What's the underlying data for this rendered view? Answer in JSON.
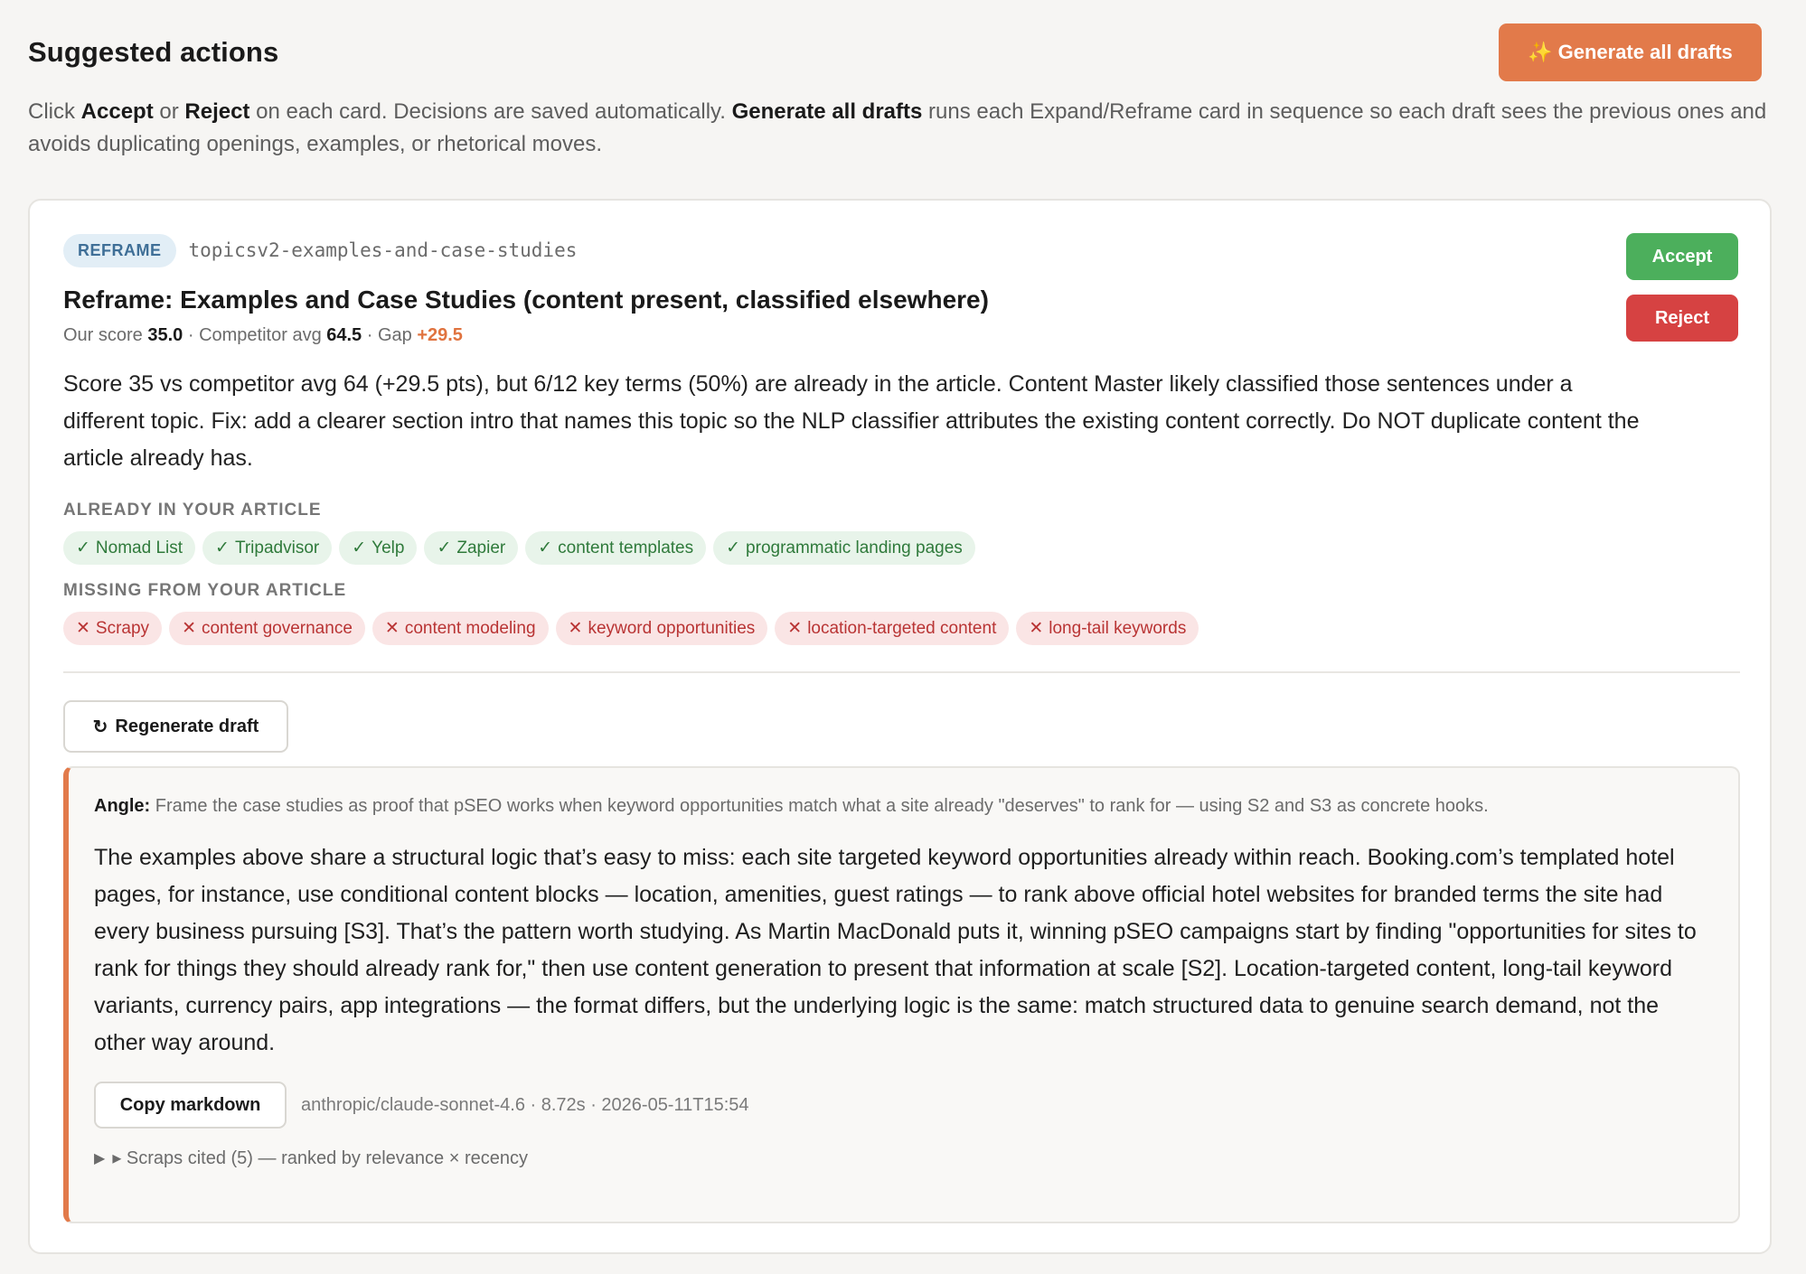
{
  "header": {
    "title": "Suggested actions",
    "generate_all": {
      "icon": "✨",
      "label": "Generate all drafts"
    }
  },
  "intro": {
    "t1": "Click ",
    "b1": "Accept",
    "t2": " or ",
    "b2": "Reject",
    "t3": " on each card. Decisions are saved automatically. ",
    "b3": "Generate all drafts",
    "t4": " runs each Expand/Reframe card in sequence so each draft sees the previous ones and avoids duplicating openings, examples, or rhetorical moves."
  },
  "card": {
    "tag": "REFRAME",
    "slug": "topicsv2-examples-and-case-studies",
    "title": "Reframe: Examples and Case Studies (content present, classified elsewhere)",
    "score": {
      "our_label": "Our score ",
      "our_value": "35.0",
      "comp_label": " · Competitor avg ",
      "comp_value": "64.5",
      "gap_label": " · Gap ",
      "gap_value": "+29.5"
    },
    "description": "Score 35 vs competitor avg 64 (+29.5 pts), but 6/12 key terms (50%) are already in the article. Content Master likely classified those sentences under a different topic. Fix: add a clearer section intro that names this topic so the NLP classifier attributes the existing content correctly. Do NOT duplicate content the article already has.",
    "already_label": "ALREADY IN YOUR ARTICLE",
    "already": [
      "Nomad List",
      "Tripadvisor",
      "Yelp",
      "Zapier",
      "content templates",
      "programmatic landing pages"
    ],
    "missing_label": "MISSING FROM YOUR ARTICLE",
    "missing": [
      "Scrapy",
      "content governance",
      "content modeling",
      "keyword opportunities",
      "location-targeted content",
      "long-tail keywords"
    ],
    "check_glyph": "✓",
    "cross_glyph": "✕",
    "regenerate": {
      "icon": "↻",
      "label": "Regenerate draft"
    },
    "accept": "Accept",
    "reject": "Reject"
  },
  "draft": {
    "angle_label": "Angle:",
    "angle_text": " Frame the case studies as proof that pSEO works when keyword opportunities match what a site already \"deserves\" to rank for — using S2 and S3 as concrete hooks.",
    "body": "The examples above share a structural logic that’s easy to miss: each site targeted keyword opportunities already within reach. Booking.com’s templated hotel pages, for instance, use conditional content blocks — location, amenities, guest ratings — to rank above official hotel websites for branded terms the site had every business pursuing [S3]. That’s the pattern worth studying. As Martin MacDonald puts it, winning pSEO campaigns start by finding \"opportunities for sites to rank for things they should already rank for,\" then use content generation to present that information at scale [S2]. Location-targeted content, long-tail keyword variants, currency pairs, app integrations — the format differs, but the underlying logic is the same: match structured data to genuine search demand, not the other way around.",
    "copy_label": "Copy markdown",
    "meta": "anthropic/claude-sonnet-4.6 · 8.72s · 2026-05-11T15:54",
    "scraps": "▸ Scraps cited (5) — ranked by relevance × recency",
    "scraps_toggle": "▶"
  }
}
